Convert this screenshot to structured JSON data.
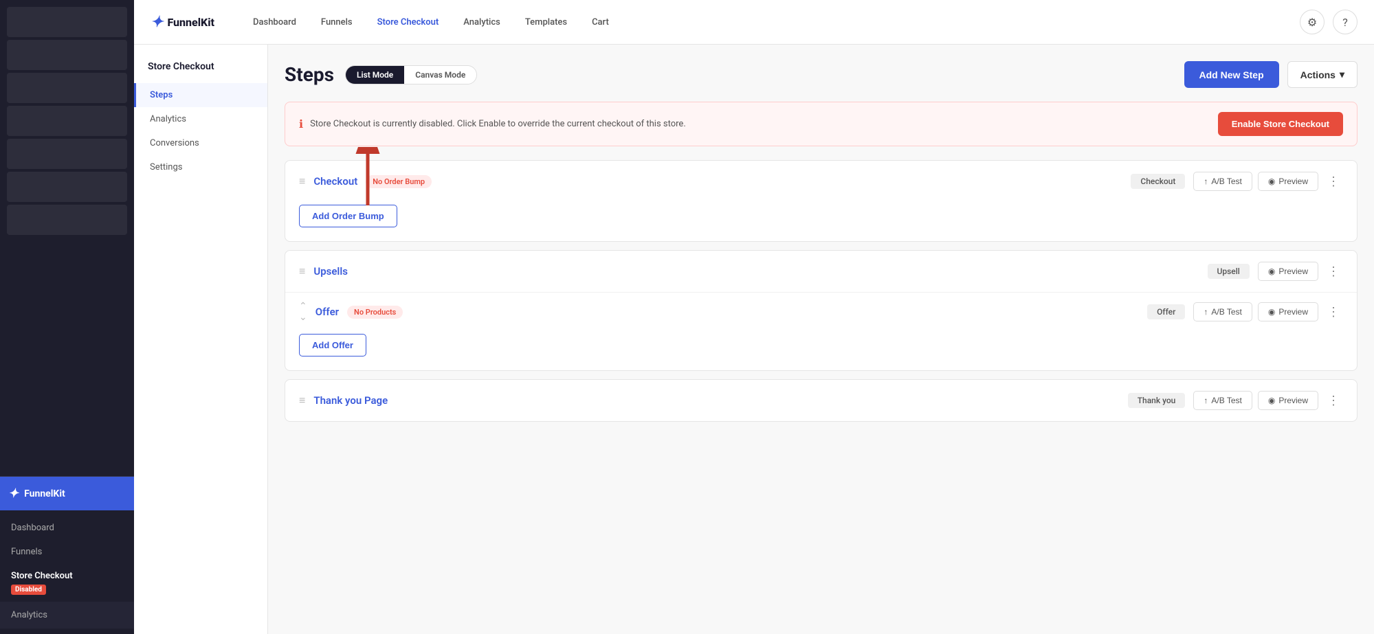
{
  "sidebar_dark": {
    "brand": "FunnelKit",
    "nav_items": [
      {
        "label": "Dashboard",
        "active": false
      },
      {
        "label": "Funnels",
        "active": false
      },
      {
        "label": "Store Checkout",
        "active": true
      },
      {
        "label": "Analytics",
        "active": false
      }
    ],
    "store_checkout_label": "Store Checkout",
    "disabled_badge": "Disabled",
    "analytics_label": "Analytics"
  },
  "top_nav": {
    "logo": "FunnelKit",
    "links": [
      {
        "label": "Dashboard",
        "active": false
      },
      {
        "label": "Funnels",
        "active": false
      },
      {
        "label": "Store Checkout",
        "active": true
      },
      {
        "label": "Analytics",
        "active": false
      },
      {
        "label": "Templates",
        "active": false
      },
      {
        "label": "Cart",
        "active": false
      }
    ]
  },
  "left_sidebar": {
    "title": "Store Checkout",
    "nav_items": [
      {
        "label": "Steps",
        "active": true
      },
      {
        "label": "Analytics",
        "active": false
      },
      {
        "label": "Conversions",
        "active": false
      },
      {
        "label": "Settings",
        "active": false
      }
    ]
  },
  "steps_page": {
    "title": "Steps",
    "mode_list": "List Mode",
    "mode_canvas": "Canvas Mode",
    "add_new_step": "Add New Step",
    "actions_label": "Actions"
  },
  "alert": {
    "text": "Store Checkout is currently disabled. Click Enable to override the current checkout of this store.",
    "button": "Enable Store Checkout"
  },
  "step_cards": [
    {
      "id": "checkout",
      "name": "Checkout",
      "badge": "No Order Bump",
      "badge_type": "warning",
      "type_label": "Checkout",
      "has_ab_test": true,
      "has_preview": true,
      "has_more": true,
      "add_button": "Add Order Bump",
      "show_arrow": true
    },
    {
      "id": "upsells",
      "name": "Upsells",
      "badge": null,
      "type_label": "Upsell",
      "has_ab_test": false,
      "has_preview": true,
      "has_more": true,
      "sub_items": [
        {
          "name": "Offer",
          "badge": "No Products",
          "badge_type": "warning",
          "type_label": "Offer",
          "has_ab_test": true,
          "has_preview": true,
          "has_more": true
        }
      ],
      "add_button": "Add Offer"
    },
    {
      "id": "thank-you",
      "name": "Thank you Page",
      "badge": null,
      "type_label": "Thank you",
      "has_ab_test": true,
      "has_preview": true,
      "has_more": true
    }
  ]
}
